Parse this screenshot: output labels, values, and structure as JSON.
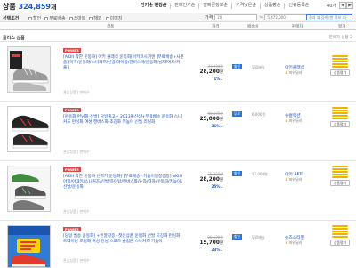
{
  "header": {
    "title_label": "상품",
    "count": "324,859",
    "count_unit": "개",
    "tabs": [
      {
        "label": "인기순 랭킹순"
      },
      {
        "label": "판매인기순"
      },
      {
        "label": "발빠른정보순"
      },
      {
        "label": "가격낮은순"
      },
      {
        "label": "상품평순"
      },
      {
        "label": "신규등록순"
      }
    ],
    "page": "40개"
  },
  "filters": {
    "label": "선택조건",
    "options": [
      "할인",
      "무료배송",
      "스마트",
      "해외",
      "이미지"
    ],
    "price_label": "가격",
    "price_min_placeholder": "20",
    "price_max_placeholder": "5,472,000",
    "apply_label": "적용",
    "search_placeholder": "결과 내 검색 (한 정보 조)"
  },
  "columns": {
    "product": "상품",
    "price": "가격",
    "shipping": "배송비",
    "seller": "판매자",
    "rating": "평가"
  },
  "plus_section": {
    "label": "플러스 상품",
    "right_label": "판매자 상품 2"
  },
  "products": [
    {
      "badge": "POWER",
      "title": "[AKIII 착한 운동화] 아키 클래식 운동화[아키코시기앤 [무료배송+사은품] 아키/운동화/스니커즈/신발/하이탑/캔버스화/운동화/남자/여자/커플]",
      "meta": "관심상품 | 판매수",
      "orig": "31,900원",
      "price": "28,200",
      "price_unit": "원",
      "discount": "1%↓",
      "ship_badge": "할인",
      "ship_val": "무료배송",
      "seller": "아키클래식",
      "grade": "파워딜러",
      "rating_label": "상품평가"
    },
    {
      "badge": "POWER",
      "title": "[운동화 런닝화 신발] 당일출고~ 2013볼신상+무료배송 운동화 스니커즈 런닝화 여성 캔버스화 조깅화 키높이 신발 러닝화",
      "meta": "관심상품 | 판매수",
      "orig": "40,500원",
      "price": "25,800",
      "price_unit": "원",
      "discount": "36%↓",
      "ship_badge": "무료",
      "ship_val": "6,000원",
      "seller": "슈컬렉션",
      "grade": "파워딜러",
      "rating_label": "상품평가"
    },
    {
      "badge": "POWER",
      "title": "[AKIII 착한 운동화 신학기 운동화] [무료배송+키높이깔창증정] AKIII 아키/아재키/스니커즈/신발/하이탑/캔버스화/남자/여자/운동화/키높이/신발/운동화",
      "meta": "관심상품 | 판매수",
      "orig": "35,900원",
      "price": "28,200",
      "price_unit": "원",
      "discount": "25%↓",
      "ship_badge": "할인",
      "ship_val": "12,000원",
      "seller": "아키 AKIII",
      "grade": "파워딜러",
      "rating_label": "상품평가"
    },
    {
      "badge": "POWER",
      "title": "[당일 발송 운동화] +빈깔창증+첫신상품 운동화 신발 조깅화 런닝화 트레이닝 조깅화 여성 런닝 스포츠 슬립온 스니커즈 키높이",
      "meta": "관심상품 | 판매수",
      "orig": "20,500원",
      "price": "15,700",
      "price_unit": "원",
      "discount": "23%↓",
      "ship_badge": "할인",
      "ship_val": "무료배송",
      "seller": "슈즈스타일",
      "grade": "파워딜러",
      "rating_label": "상품평가"
    }
  ],
  "colors": {
    "accent": "#1a57d6",
    "badge": "#e04848",
    "ship": "#2a77d5",
    "rating_bar": "#f2b300"
  }
}
